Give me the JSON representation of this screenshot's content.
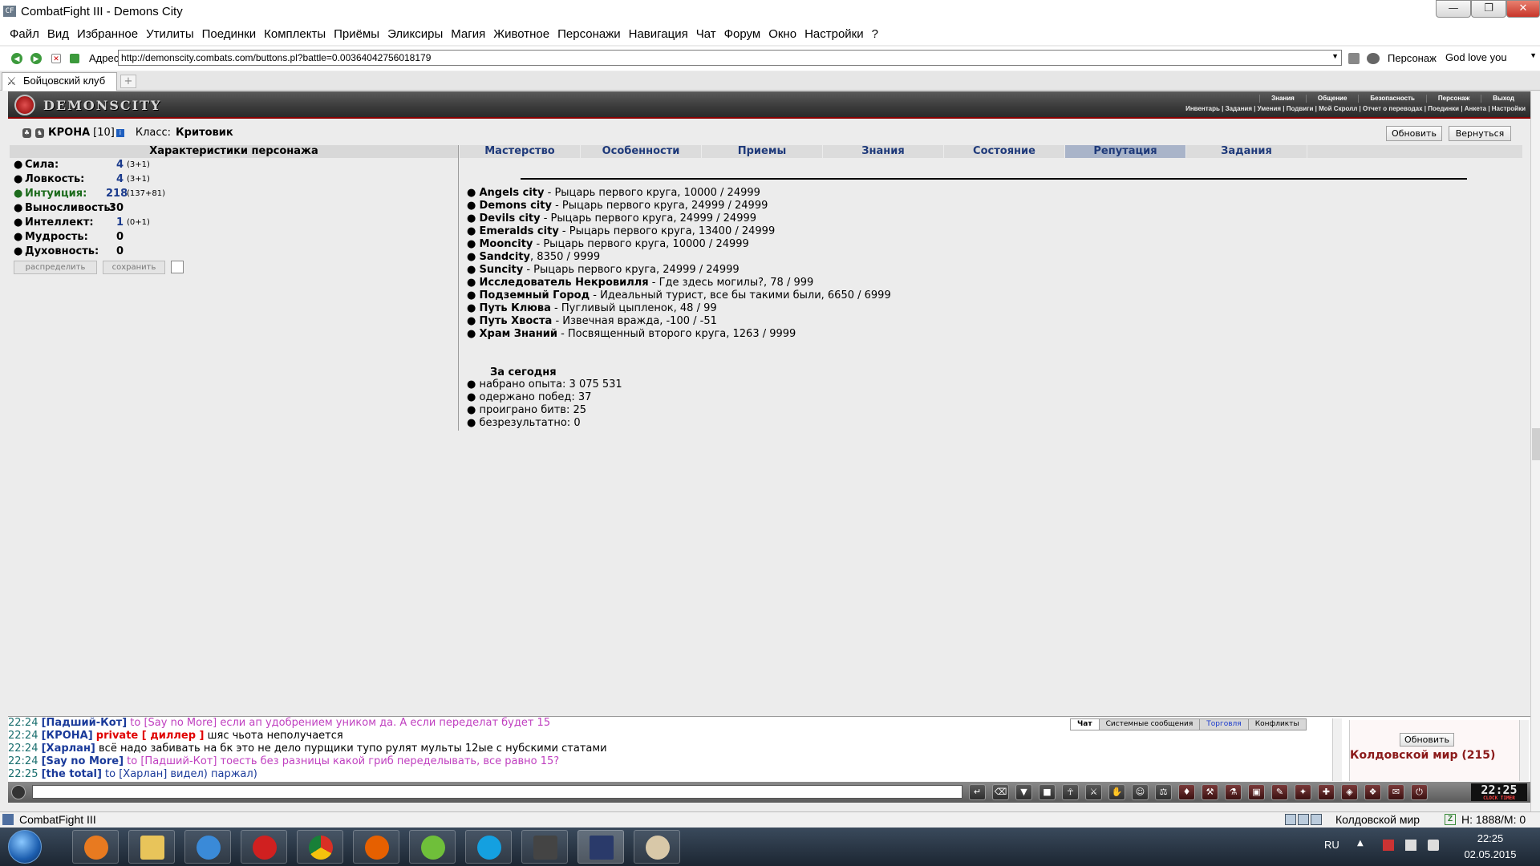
{
  "window": {
    "app_icon": "CF",
    "title": "CombatFight III - Demons City",
    "minimize": "—",
    "maximize": "❐",
    "close": "✕"
  },
  "menu": [
    "Файл",
    "Вид",
    "Избранное",
    "Утилиты",
    "Поединки",
    "Комплекты",
    "Приёмы",
    "Эликсиры",
    "Магия",
    "Животное",
    "Персонажи",
    "Навигация",
    "Чат",
    "Форум",
    "Окно",
    "Настройки",
    "?"
  ],
  "address": {
    "label": "Адрес",
    "url": "http://demonscity.combats.com/buttons.pl?battle=0.00364042756018179",
    "person_label": "Персонаж",
    "person_value": "God love you"
  },
  "browser_tab": {
    "label": "Бойцовский клуб",
    "new_tab": "+"
  },
  "game_header": {
    "logo": "DEMONSCITY",
    "top_nav": [
      "Знания",
      "Общение",
      "Безопасность",
      "Персонаж",
      "Выход"
    ],
    "sub_nav": "Инвентарь | Задания | Умения | Подвиги | Мой Скролл | Отчет о переводах | Поединки | Анкета | Настройки"
  },
  "character": {
    "name": "КРОНА",
    "level": "[10]",
    "info_icon": "i",
    "class_label": "Класс:",
    "class_value": "Критовик",
    "update_button": "Обновить",
    "back_button": "Вернуться"
  },
  "stats": {
    "title": "Характеристики персонажа",
    "rows": [
      {
        "label": "Сила:",
        "value": "4",
        "extra": "(3+1)"
      },
      {
        "label": "Ловкость:",
        "value": "4",
        "extra": "(3+1)"
      },
      {
        "label": "Интуиция:",
        "value": "218",
        "extra": "(137+81)"
      },
      {
        "label": "Выносливость:",
        "value": "30",
        "extra": ""
      },
      {
        "label": "Интеллект:",
        "value": "1",
        "extra": "(0+1)"
      },
      {
        "label": "Мудрость:",
        "value": "0",
        "extra": ""
      },
      {
        "label": "Духовность:",
        "value": "0",
        "extra": ""
      }
    ],
    "distribute_button": "распределить",
    "save_button": "сохранить"
  },
  "content_tabs": [
    "Мастерство",
    "Особенности",
    "Приемы",
    "Знания",
    "Состояние",
    "Репутация",
    "Задания"
  ],
  "active_tab": "Репутация",
  "reputation": [
    {
      "city": "Angels city",
      "text": " - Рыцарь первого круга, 10000 / 24999"
    },
    {
      "city": "Demons city",
      "text": " - Рыцарь первого круга, 24999 / 24999"
    },
    {
      "city": "Devils city",
      "text": " - Рыцарь первого круга, 24999 / 24999"
    },
    {
      "city": "Emeralds city",
      "text": " - Рыцарь первого круга, 13400 / 24999"
    },
    {
      "city": "Mooncity",
      "text": " - Рыцарь первого круга, 10000 / 24999"
    },
    {
      "city": "Sandcity",
      "text": ", 8350 / 9999"
    },
    {
      "city": "Suncity",
      "text": " - Рыцарь первого круга, 24999 / 24999"
    },
    {
      "city": "Исследователь Некровилля",
      "text": " - Где здесь могилы?, 78 / 999"
    },
    {
      "city": "Подземный Город",
      "text": " - Идеальный турист, все бы такими были, 6650 / 6999"
    },
    {
      "city": "Путь Клюва",
      "text": " - Пугливый цыпленок, 48 / 99"
    },
    {
      "city": "Путь Хвоста",
      "text": " - Извечная вражда, -100 / -51"
    },
    {
      "city": "Храм Знаний",
      "text": " - Посвященный второго круга, 1263 / 9999"
    }
  ],
  "today": {
    "title": "За сегодня",
    "items": [
      "набрано опыта: 3 075 531",
      "одержано побед: 37",
      "проиграно битв: 25",
      "безрезультатно: 0"
    ]
  },
  "chat": {
    "lines": [
      {
        "time": "22:24",
        "nick": "[Падший-Кот]",
        "private": "",
        "to": " to [Say no More] если ап удобрением уником да. А если переделат будет 15",
        "to_style": "to",
        "message": ""
      },
      {
        "time": "22:24",
        "nick": "[КРОНА]",
        "private": "private [ диллер ]",
        "to": "",
        "to_style": "",
        "message": " шяс чьота неполучается"
      },
      {
        "time": "22:24",
        "nick": "[Харлан]",
        "private": "",
        "to": "",
        "to_style": "",
        "message": " всё надо забивать на бк это не дело пурщики тупо рулят мульты 12ые с нубскими статами"
      },
      {
        "time": "22:24",
        "nick": "[Say no More]",
        "private": "",
        "to": " to [Падший-Кот] тоесть без разницы какой гриб переделывать, все равно 15?",
        "to_style": "to",
        "message": ""
      },
      {
        "time": "22:25",
        "nick": "[the total]",
        "private": "",
        "to": " to [Харлан] видел) паржал)",
        "to_style": "to-blue",
        "message": ""
      }
    ],
    "tabs": [
      "Чат",
      "Системные сообщения",
      "Торговля",
      "Конфликты"
    ],
    "update_button": "Обновить",
    "world_title": "Колдовской мир (215)"
  },
  "toolbar": {
    "icons": [
      "enter-icon",
      "eraser-icon",
      "filter-icon",
      "save-icon",
      "fighter-icon",
      "sword-icon",
      "hand-icon",
      "smile-icon",
      "trade-icon",
      "bag-icon",
      "axe-icon",
      "potion-icon",
      "chest-icon",
      "scroll-icon",
      "rune-icon",
      "plus-icon",
      "pack-icon",
      "book-icon",
      "speech-icon",
      "exit-icon"
    ],
    "clock": "22:25",
    "clock_sub": "CLOCK TIMER"
  },
  "statusbar": {
    "title": "CombatFight III",
    "world": "Колдовской мир",
    "green_icon": "Z",
    "hm": "H: 1888/M: 0"
  },
  "taskbar": {
    "apps": [
      "media-player",
      "explorer",
      "internet-explorer",
      "opera",
      "chrome",
      "firefox",
      "utorrent",
      "skype",
      "world-of-tanks",
      "combatfight",
      "paint"
    ],
    "lang": "RU",
    "time": "22:25",
    "date": "02.05.2015"
  }
}
